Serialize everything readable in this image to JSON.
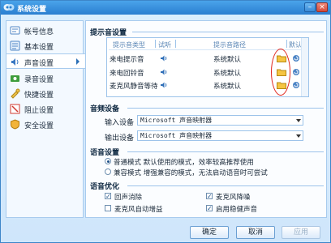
{
  "window": {
    "title": "系统设置"
  },
  "sidebar": {
    "items": [
      {
        "label": "帐号信息",
        "icon": "account-icon"
      },
      {
        "label": "基本设置",
        "icon": "basic-settings-icon"
      },
      {
        "label": "声音设置",
        "icon": "sound-settings-icon",
        "active": true
      },
      {
        "label": "录音设置",
        "icon": "record-icon"
      },
      {
        "label": "快捷设置",
        "icon": "shortcut-icon"
      },
      {
        "label": "阻止设置",
        "icon": "block-icon"
      },
      {
        "label": "安全设置",
        "icon": "security-icon"
      }
    ]
  },
  "sound_section": {
    "title": "提示音设置",
    "headers": {
      "type": "提示音类型",
      "preview": "试听",
      "path": "提示音路径",
      "default": "默认"
    },
    "rows": [
      {
        "type": "来电提示音",
        "path": "系统默认"
      },
      {
        "type": "来电回铃音",
        "path": "系统默认"
      },
      {
        "type": "麦克风静音等待",
        "path": "系统默认"
      }
    ]
  },
  "device_section": {
    "title": "音频设备",
    "input_label": "输入设备",
    "input_value": "Microsoft 声音映射器",
    "output_label": "输出设备",
    "output_value": "Microsoft 声音映射器"
  },
  "voice_section": {
    "title": "语音设置",
    "normal_mode": "普通模式  默认使用的模式，效率较高推荐使用",
    "compat_mode": "兼容模式  增强兼容的模式，无法启动语音时可尝试"
  },
  "optimize_section": {
    "title": "语音优化",
    "echo_cancel": "回声消除",
    "auto_gain": "麦克风自动增益",
    "noise_reduce": "麦克风降噪",
    "robust_audio": "启用稳健声音"
  },
  "buttons": {
    "ok": "确定",
    "cancel": "取消",
    "apply": "应用"
  }
}
